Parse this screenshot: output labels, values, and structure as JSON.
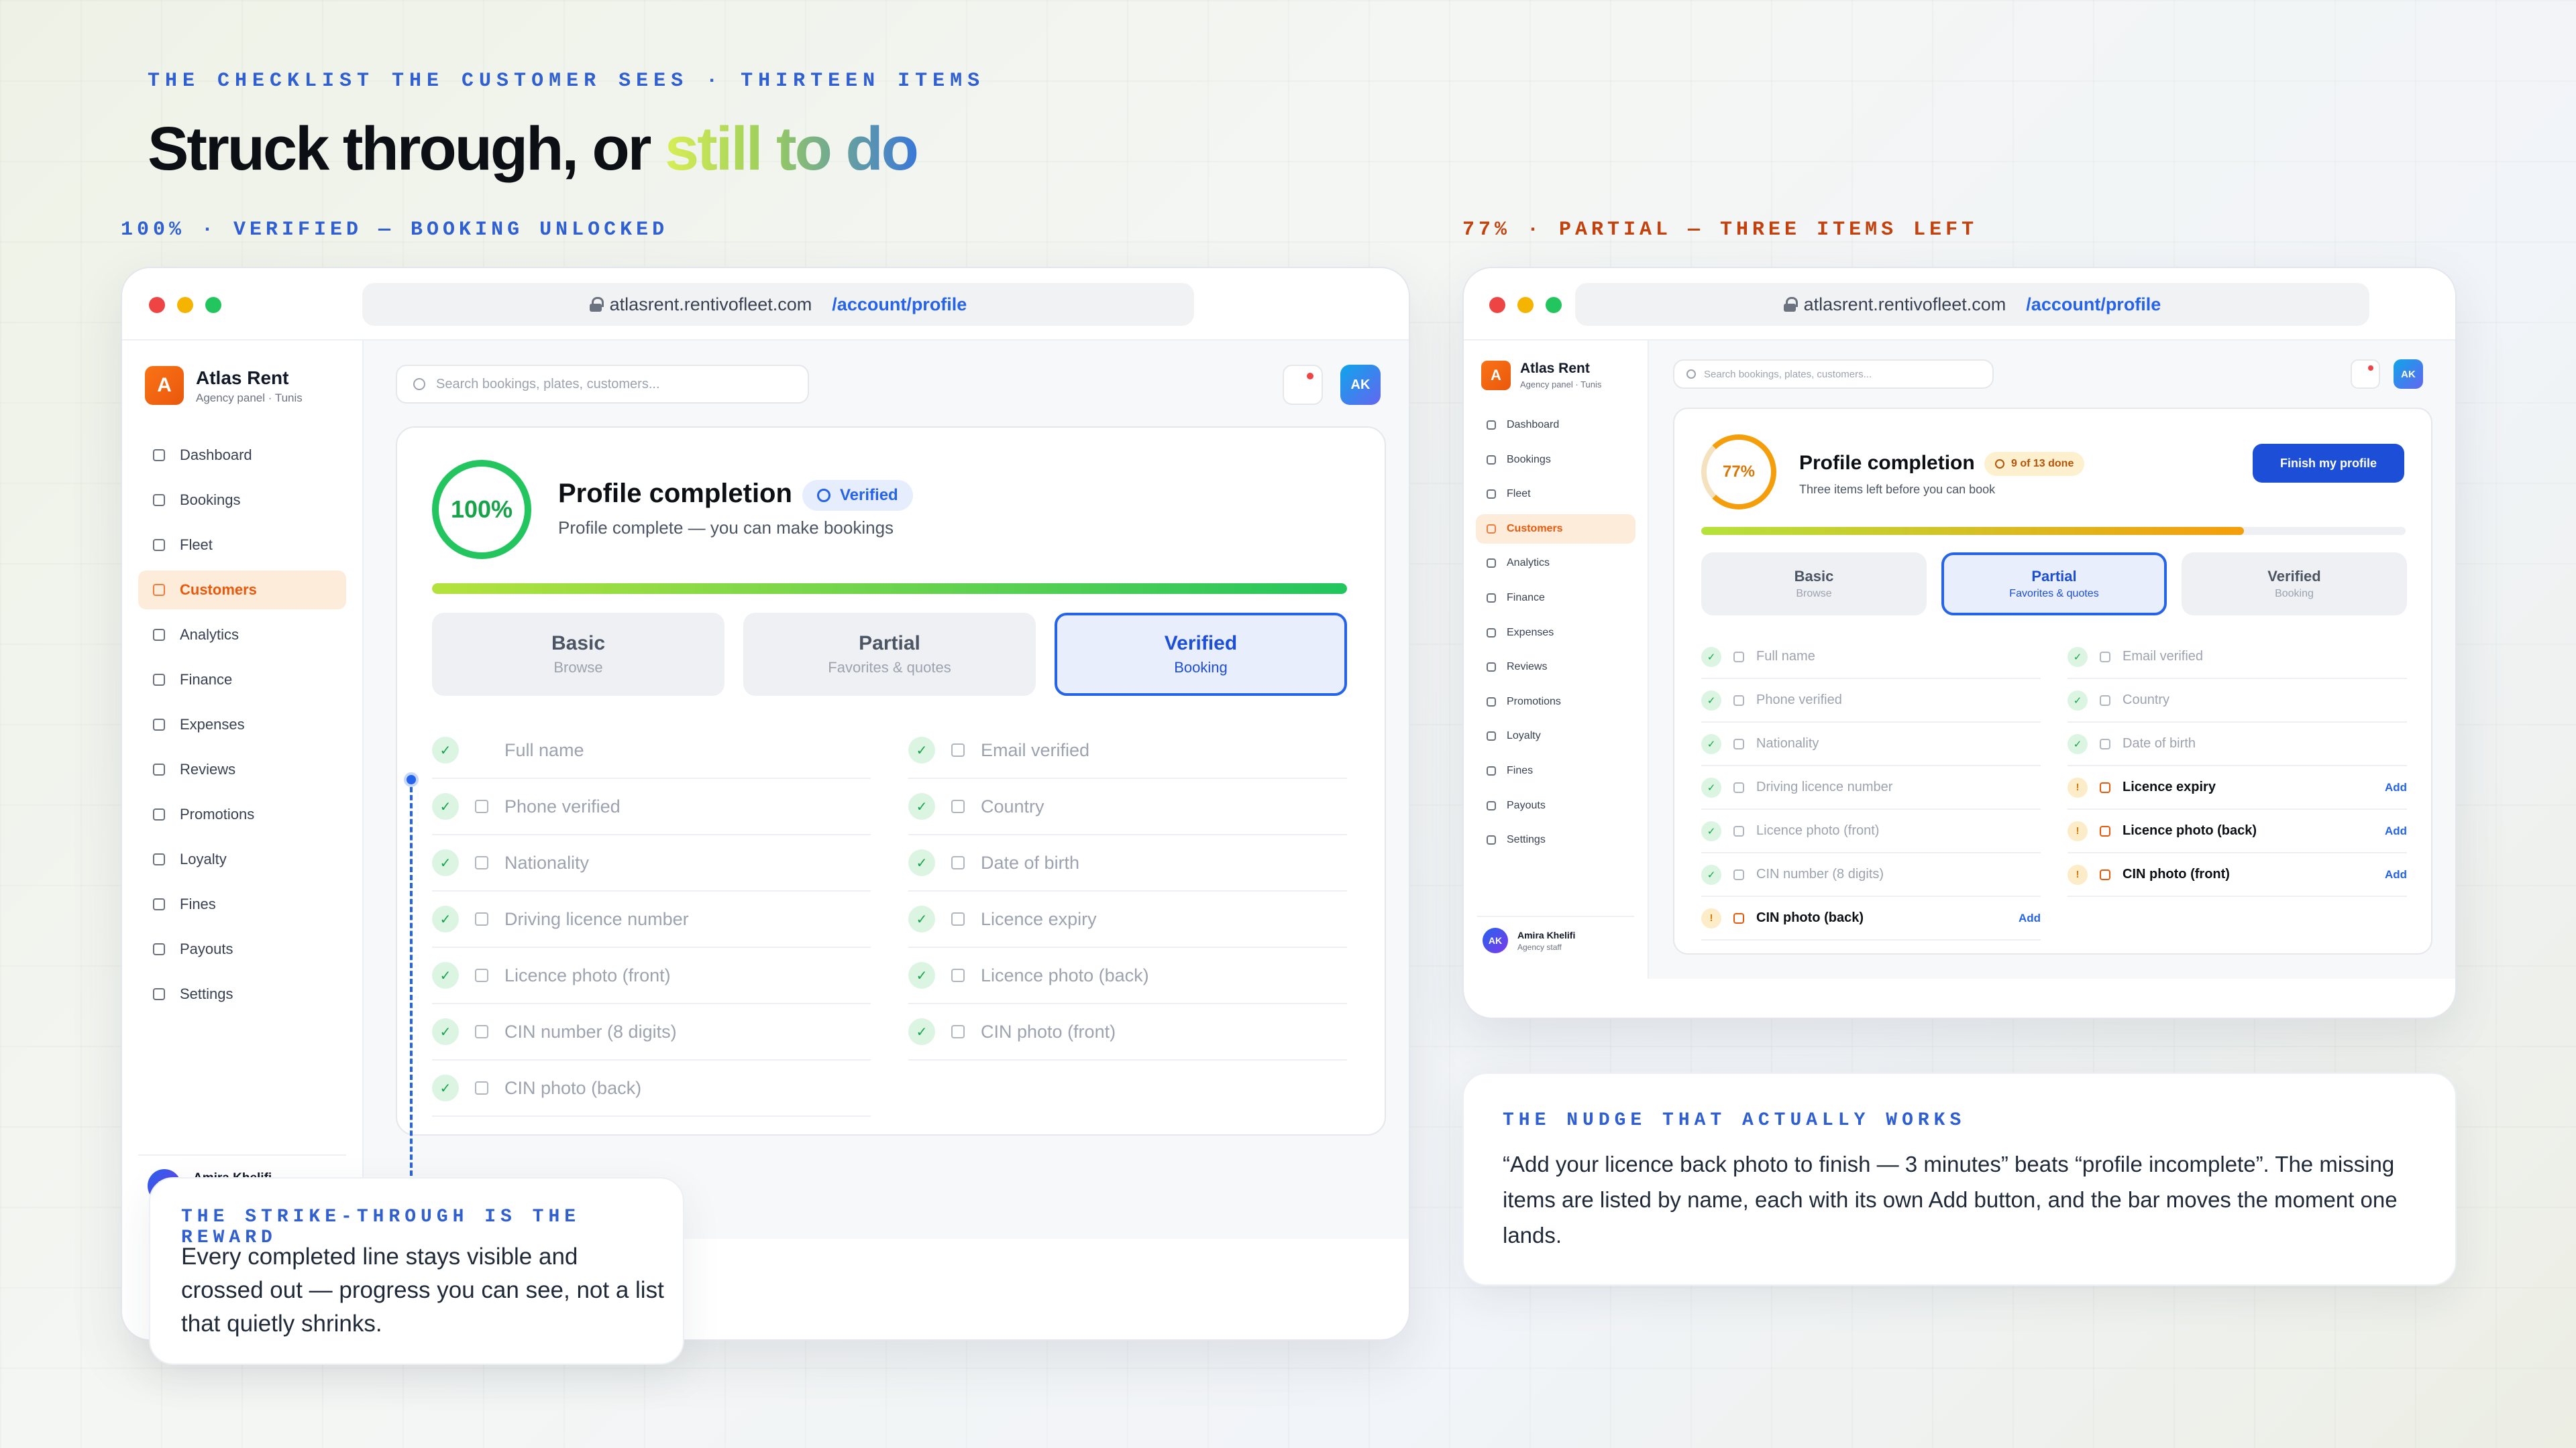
{
  "eyebrow": "THE CHECKLIST THE CUSTOMER SEES · THIRTEEN ITEMS",
  "headline": {
    "lead": "Struck through, or ",
    "accent": "still to do"
  },
  "left_label": "100% · VERIFIED — BOOKING UNLOCKED",
  "right_label": "77% · PARTIAL — THREE ITEMS LEFT",
  "colors": {
    "accent_blue": "#2563eb",
    "success_green": "#16a34a",
    "warning_orange": "#f59e0b",
    "brand_orange": "#ea580c"
  },
  "browser": {
    "domain": "atlasrent.rentivofleet.com",
    "path": "/account/profile"
  },
  "app": {
    "name": "Atlas Rent",
    "subtitle": "Agency panel · Tunis",
    "logo_letter": "A"
  },
  "nav": [
    {
      "label": "Dashboard",
      "icon": "grid-icon"
    },
    {
      "label": "Bookings",
      "icon": "calendar-icon"
    },
    {
      "label": "Fleet",
      "icon": "car-icon"
    },
    {
      "label": "Customers",
      "icon": "users-icon"
    },
    {
      "label": "Analytics",
      "icon": "bar-chart-icon"
    },
    {
      "label": "Finance",
      "icon": "wallet-icon"
    },
    {
      "label": "Expenses",
      "icon": "receipt-icon"
    },
    {
      "label": "Reviews",
      "icon": "star-icon"
    },
    {
      "label": "Promotions",
      "icon": "tag-icon"
    },
    {
      "label": "Loyalty",
      "icon": "crown-icon"
    },
    {
      "label": "Fines",
      "icon": "shield-icon"
    },
    {
      "label": "Payouts",
      "icon": "payout-icon"
    },
    {
      "label": "Settings",
      "icon": "gear-icon"
    }
  ],
  "user": {
    "initials": "AK",
    "name": "Amira Khelifi",
    "role": "Agency staff"
  },
  "search_placeholder": "Search bookings, plates, customers...",
  "top_avatar": "AK",
  "left_card": {
    "percent_label": "100%",
    "percent": 100,
    "title": "Profile completion",
    "badge": "Verified",
    "subtitle": "Profile complete — you can make bookings",
    "tiers": [
      {
        "name": "Basic",
        "sub": "Browse"
      },
      {
        "name": "Partial",
        "sub": "Favorites & quotes"
      },
      {
        "name": "Verified",
        "sub": "Booking"
      }
    ],
    "left_column": [
      {
        "label": "Full name",
        "icon": ""
      },
      {
        "label": "Phone verified",
        "icon": "phone-icon"
      },
      {
        "label": "Nationality",
        "icon": "globe-icon"
      },
      {
        "label": "Driving licence number",
        "icon": "document-icon"
      },
      {
        "label": "Licence photo (front)",
        "icon": "camera-icon"
      },
      {
        "label": "CIN number (8 digits)",
        "icon": "id-card-icon"
      },
      {
        "label": "CIN photo (back)",
        "icon": "camera-icon"
      }
    ],
    "right_column": [
      {
        "label": "Email verified",
        "icon": "mail-icon"
      },
      {
        "label": "Country",
        "icon": "globe-icon"
      },
      {
        "label": "Date of birth",
        "icon": "calendar-icon"
      },
      {
        "label": "Licence expiry",
        "icon": "calendar-icon"
      },
      {
        "label": "Licence photo (back)",
        "icon": "camera-icon"
      },
      {
        "label": "CIN photo (front)",
        "icon": "camera-icon"
      }
    ]
  },
  "right_card": {
    "percent_label": "77%",
    "percent": 77,
    "title": "Profile completion",
    "badge": "9 of 13 done",
    "subtitle": "Three items left before you can book",
    "button": "Finish my profile",
    "left_column": [
      {
        "label": "Full name",
        "done": true
      },
      {
        "label": "Phone verified",
        "done": true
      },
      {
        "label": "Nationality",
        "done": true
      },
      {
        "label": "Driving licence number",
        "done": true
      },
      {
        "label": "Licence photo (front)",
        "done": true
      },
      {
        "label": "CIN number (8 digits)",
        "done": true
      },
      {
        "label": "CIN photo (back)",
        "done": false
      }
    ],
    "right_column": [
      {
        "label": "Email verified",
        "done": true
      },
      {
        "label": "Country",
        "done": true
      },
      {
        "label": "Date of birth",
        "done": true
      },
      {
        "label": "Licence expiry",
        "done": false
      },
      {
        "label": "Licence photo (back)",
        "done": false
      },
      {
        "label": "CIN photo (front)",
        "done": false
      }
    ],
    "add_label": "Add"
  },
  "note_left": {
    "eyebrow": "THE STRIKE-THROUGH IS THE REWARD",
    "text": "Every completed line stays visible and crossed out — progress you can see, not a list that quietly shrinks."
  },
  "note_right": {
    "eyebrow": "THE NUDGE THAT ACTUALLY WORKS",
    "text": "“Add your licence back photo to finish — 3 minutes” beats “profile incomplete”. The missing items are listed by name, each with its own Add button, and the bar moves the moment one lands."
  }
}
